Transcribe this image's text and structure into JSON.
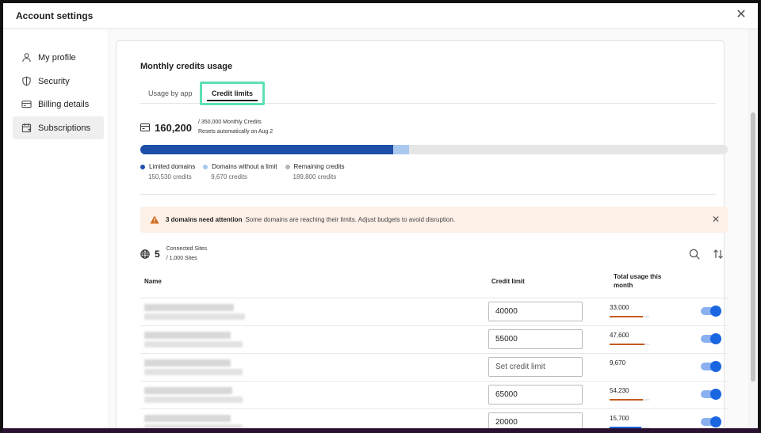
{
  "window": {
    "title": "Account settings"
  },
  "sidebar": {
    "items": [
      {
        "label": "My profile",
        "icon": "person-icon",
        "active": false
      },
      {
        "label": "Security",
        "icon": "shield-icon",
        "active": false
      },
      {
        "label": "Billing details",
        "icon": "card-icon",
        "active": false
      },
      {
        "label": "Subscriptions",
        "icon": "calendar-icon",
        "active": true
      }
    ]
  },
  "main": {
    "section_title": "Monthly credits usage",
    "tabs": [
      {
        "label": "Usage by app",
        "active": false
      },
      {
        "label": "Credit limits",
        "active": true
      }
    ],
    "credits": {
      "used": "160,200",
      "total_text": "/ 350,000 Monthly Credits",
      "reset_text": "Resets automatically on Aug 2"
    },
    "usage_bar": {
      "total": 350000,
      "segments": [
        {
          "name": "Limited domains",
          "value": 150530,
          "color": "#1e4fa8"
        },
        {
          "name": "Domains without a limit",
          "value": 9670,
          "color": "#a9c8ee"
        },
        {
          "name": "Remaining credits",
          "value": 189800,
          "color": "#e6e6e6"
        }
      ]
    },
    "legend": [
      {
        "label": "Limited domains",
        "sub": "150,530 credits",
        "color": "#1e4fa8"
      },
      {
        "label": "Domains without a limit",
        "sub": "9,670 credits",
        "color": "#a9c8ee"
      },
      {
        "label": "Remaining credits",
        "sub": "189,800 credits",
        "color": "#b5b5b5"
      }
    ],
    "alert": {
      "strong": "3 domains need attention",
      "text": "Some domains are reaching their limits. Adjust budgets to avoid disruption."
    },
    "sites": {
      "count": "5",
      "label": "Connected Sites",
      "total": "/ 1,000 Sites"
    },
    "table": {
      "columns": {
        "name": "Name",
        "credit_limit": "Credit limit",
        "usage": "Total usage this month"
      },
      "rows": [
        {
          "limit": "40000",
          "placeholder": "",
          "usage": "33,000",
          "usage_fraction": 0.83,
          "usage_color": "#c45a1e",
          "enabled": true
        },
        {
          "limit": "55000",
          "placeholder": "",
          "usage": "47,600",
          "usage_fraction": 0.87,
          "usage_color": "#c45a1e",
          "enabled": true
        },
        {
          "limit": "",
          "placeholder": "Set credit limit",
          "usage": "9,670",
          "usage_fraction": 0,
          "usage_color": "#c45a1e",
          "enabled": true
        },
        {
          "limit": "65000",
          "placeholder": "",
          "usage": "54,230",
          "usage_fraction": 0.83,
          "usage_color": "#c45a1e",
          "enabled": true
        },
        {
          "limit": "20000",
          "placeholder": "",
          "usage": "15,700",
          "usage_fraction": 0.79,
          "usage_color": "#1a66e0",
          "enabled": true
        }
      ]
    }
  }
}
